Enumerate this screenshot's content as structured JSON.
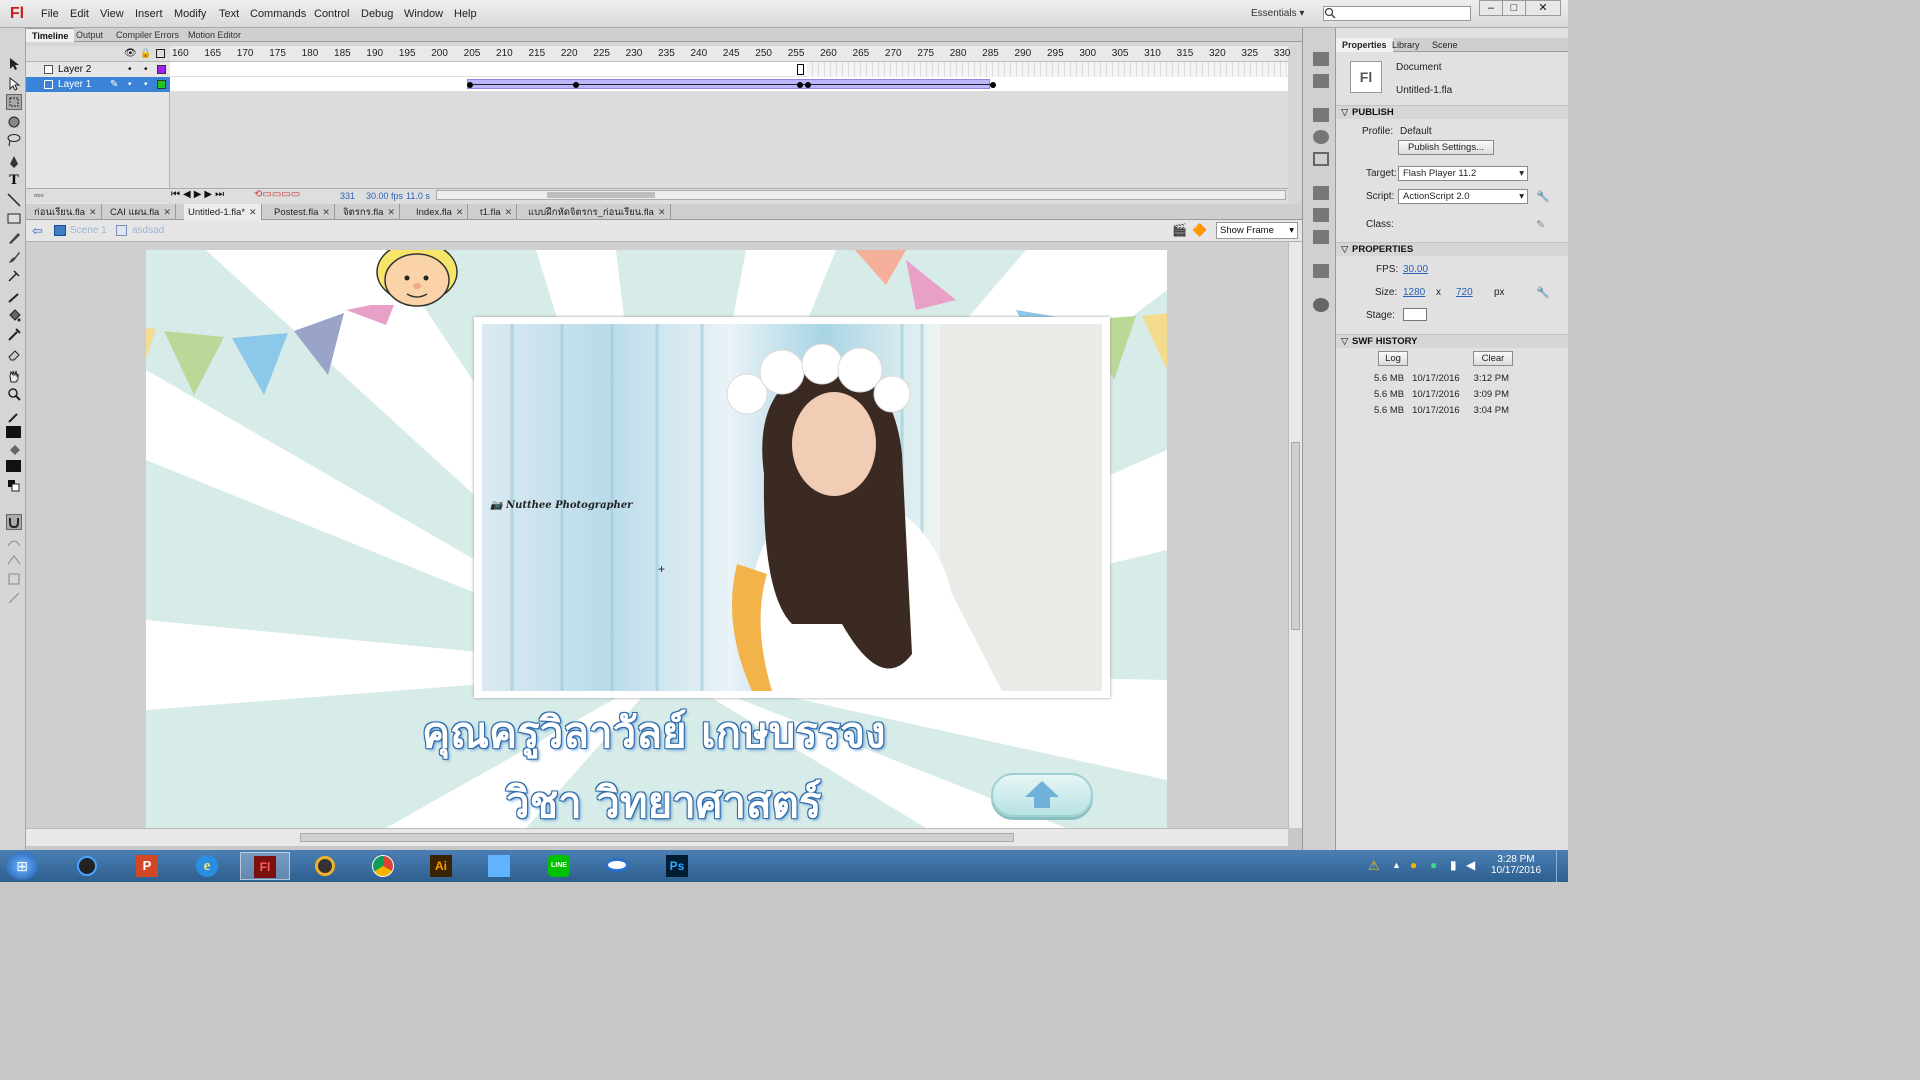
{
  "app": {
    "logo": "Fl"
  },
  "menu": [
    "File",
    "Edit",
    "View",
    "Insert",
    "Modify",
    "Text",
    "Commands",
    "Control",
    "Debug",
    "Window",
    "Help"
  ],
  "workspace": "Essentials",
  "timeline": {
    "tabs": [
      "Timeline",
      "Output",
      "Compiler Errors",
      "Motion Editor"
    ],
    "ruler": [
      "160",
      "165",
      "170",
      "175",
      "180",
      "185",
      "190",
      "195",
      "200",
      "205",
      "210",
      "215",
      "220",
      "225",
      "230",
      "235",
      "240",
      "245",
      "250",
      "255",
      "260",
      "265",
      "270",
      "275",
      "280",
      "285",
      "290",
      "295",
      "300",
      "305",
      "310",
      "315",
      "320",
      "325",
      "330"
    ],
    "layers": [
      {
        "name": "Layer 2",
        "color": "#a020f0"
      },
      {
        "name": "Layer 1",
        "color": "#22c422"
      }
    ],
    "status": {
      "frame": "331",
      "fps": "30.00 fps",
      "time": "11.0 s"
    }
  },
  "doc_tabs": [
    "ก่อนเรียน.fla",
    "CAI แผน.fla",
    "Untitled-1.fla*",
    "Postest.fla",
    "จิตรกร.fla",
    "Index.fla",
    "t1.fla",
    "แบบฝึกหัดจิตรกร_ก่อนเรียน.fla"
  ],
  "edit_bar": {
    "scene": "Scene 1",
    "symbol": "asdsad",
    "zoom": "Show Frame"
  },
  "stage": {
    "name": "คุณครูวิลาวัลย์    เกษบรรจง",
    "subject": "วิชา   วิทยาศาสตร์",
    "watermark": "Nutthee Photographer",
    "colors": {
      "bg": "#d7ece9",
      "ray": "#ffffff"
    }
  },
  "properties": {
    "tabs": [
      "Properties",
      "Library",
      "Scene"
    ],
    "doc_type": "Document",
    "doc_name": "Untitled-1.fla",
    "publish": {
      "title": "PUBLISH",
      "profile_label": "Profile:",
      "profile": "Default",
      "settings_btn": "Publish Settings...",
      "target_label": "Target:",
      "target": "Flash Player 11.2",
      "script_label": "Script:",
      "script": "ActionScript 2.0",
      "class_label": "Class:"
    },
    "props": {
      "title": "PROPERTIES",
      "fps_label": "FPS:",
      "fps": "30.00",
      "size_label": "Size:",
      "width": "1280",
      "x": "x",
      "height": "720",
      "unit": "px",
      "stage_label": "Stage:"
    },
    "swf": {
      "title": "SWF HISTORY",
      "log": "Log",
      "clear": "Clear",
      "rows": [
        {
          "size": "5.6 MB",
          "date": "10/17/2016",
          "time": "3:12 PM"
        },
        {
          "size": "5.6 MB",
          "date": "10/17/2016",
          "time": "3:09 PM"
        },
        {
          "size": "5.6 MB",
          "date": "10/17/2016",
          "time": "3:04 PM"
        }
      ]
    }
  },
  "taskbar": {
    "time": "3:28 PM",
    "date": "10/17/2016"
  }
}
